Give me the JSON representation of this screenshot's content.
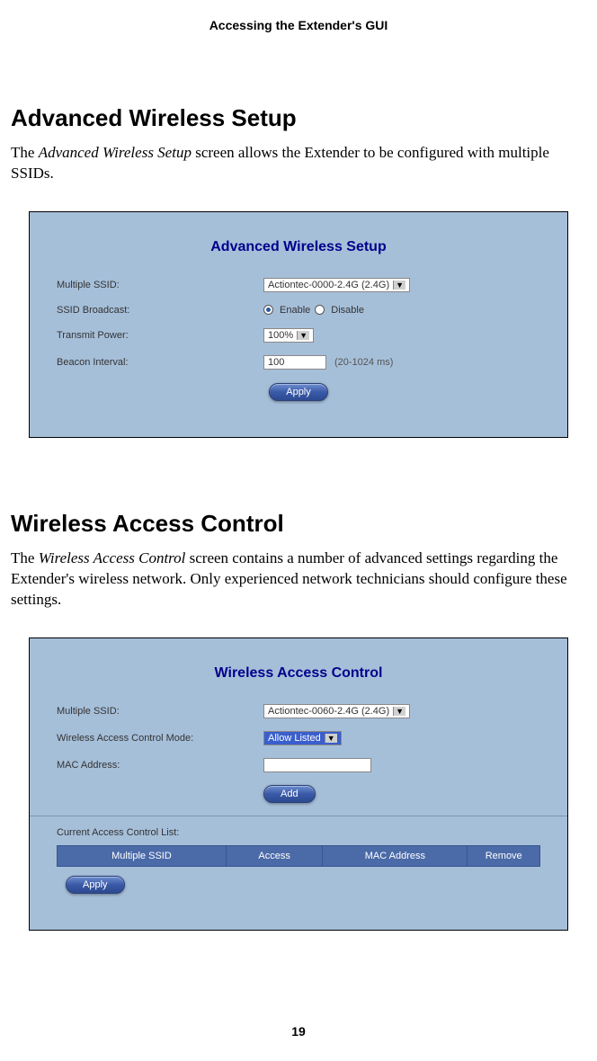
{
  "page_header": "Accessing the Extender's GUI",
  "page_number": "19",
  "section1": {
    "heading": "Advanced Wireless Setup",
    "intro_prefix": "The ",
    "intro_em": "Advanced Wireless Setup",
    "intro_suffix": " screen allows the Extender to be configured with multiple SSIDs.",
    "panel_title": "Advanced Wireless Setup",
    "multiple_ssid_label": "Multiple SSID:",
    "multiple_ssid_value": "Actiontec-0000-2.4G (2.4G)",
    "ssid_broadcast_label": "SSID Broadcast:",
    "enable_label": "Enable",
    "disable_label": "Disable",
    "transmit_power_label": "Transmit Power:",
    "transmit_power_value": "100%",
    "beacon_interval_label": "Beacon Interval:",
    "beacon_interval_value": "100",
    "beacon_interval_hint": "(20-1024 ms)",
    "apply_label": "Apply"
  },
  "section2": {
    "heading": "Wireless Access Control",
    "intro_prefix": "The ",
    "intro_em": "Wireless Access Control",
    "intro_suffix": " screen contains a number of advanced settings regarding the Extender's wireless network. Only experienced network technicians should configure these settings.",
    "panel_title": "Wireless Access Control",
    "multiple_ssid_label": "Multiple SSID:",
    "multiple_ssid_value": "Actiontec-0060-2.4G (2.4G)",
    "mode_label": "Wireless Access Control Mode:",
    "mode_value": "Allow Listed",
    "mac_label": "MAC Address:",
    "add_label": "Add",
    "list_header": "Current Access Control List:",
    "col_ssid": "Multiple SSID",
    "col_access": "Access",
    "col_mac": "MAC Address",
    "col_remove": "Remove",
    "apply_label": "Apply"
  }
}
